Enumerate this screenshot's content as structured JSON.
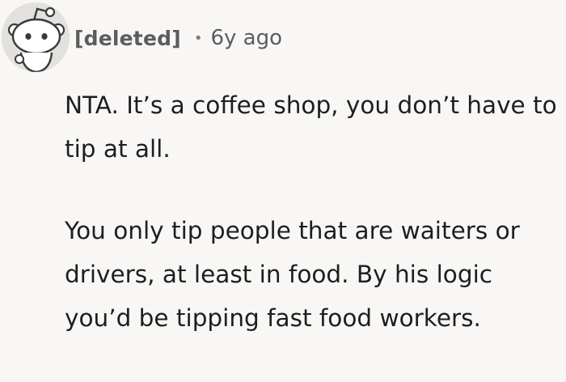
{
  "comment": {
    "author": "[deleted]",
    "separator": "•",
    "age": "6y ago",
    "avatar_icon": "reddit-snoo-icon",
    "paragraphs": [
      "NTA. It’s a coffee shop, you don’t have to tip at all.",
      "You only tip people that are waiters or drivers, at least in food. By his logic you’d be tipping fast food workers."
    ]
  },
  "colors": {
    "background": "#f8f7f5",
    "meta_text": "#5c5c5c",
    "body_text": "#1e1e1e",
    "avatar_bg": "#e2e1de"
  }
}
